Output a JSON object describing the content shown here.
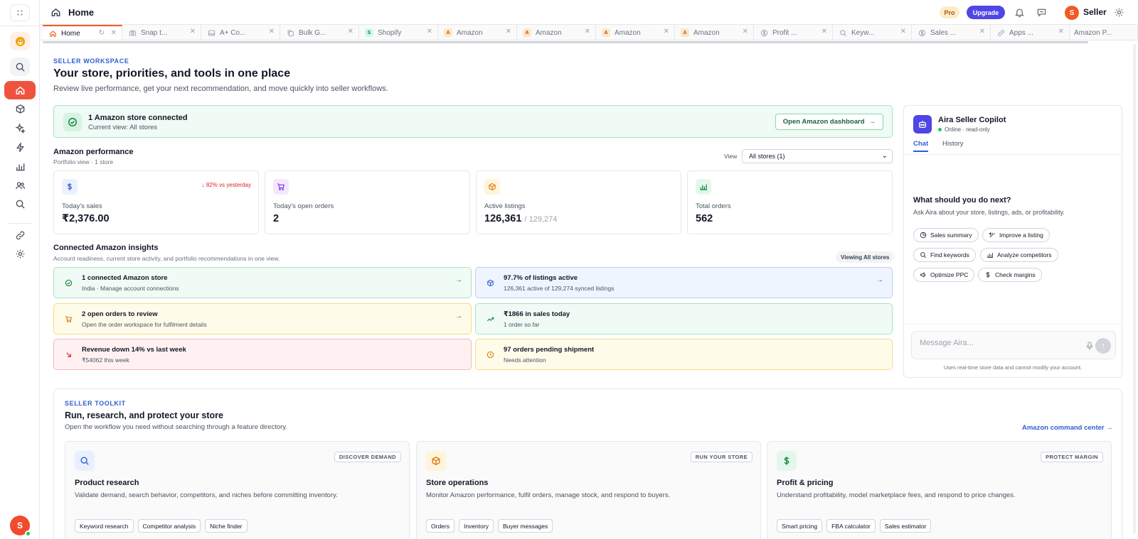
{
  "topbar": {
    "title": "Home",
    "pro_badge": "Pro",
    "upgrade_label": "Upgrade",
    "user_initial": "S",
    "user_name": "Seller"
  },
  "sidebar": {
    "avatar_initial": "S"
  },
  "tabs": [
    {
      "label": "Home"
    },
    {
      "label": "Snap t..."
    },
    {
      "label": "A+ Co..."
    },
    {
      "label": "Bulk G..."
    },
    {
      "label": "Shopify",
      "badge": "S"
    },
    {
      "label": "Amazon",
      "badge": "A"
    },
    {
      "label": "Amazon",
      "badge": "A"
    },
    {
      "label": "Amazon",
      "badge": "A"
    },
    {
      "label": "Amazon",
      "badge": "A"
    },
    {
      "label": "Profit ..."
    },
    {
      "label": "Keyw..."
    },
    {
      "label": "Sales ..."
    },
    {
      "label": "Apps ..."
    },
    {
      "label": "Amazon P..."
    }
  ],
  "hero": {
    "eyebrow": "SELLER WORKSPACE",
    "title": "Your store, priorities, and tools in one place",
    "subtitle": "Review live performance, get your next recommendation, and move quickly into seller workflows."
  },
  "connected": {
    "title": "1 Amazon store connected",
    "subtitle": "Current view: All stores",
    "button_label": "Open Amazon dashboard"
  },
  "performance": {
    "title": "Amazon performance",
    "subtitle": "Portfolio view · 1 store",
    "view_label": "View",
    "view_value": "All stores (1)",
    "kpis": [
      {
        "label": "Today's sales",
        "value": "₹2,376.00",
        "delta": "↓ 82% vs yesterday",
        "icon": "dollar-icon"
      },
      {
        "label": "Today's open orders",
        "value": "2",
        "icon": "cart-icon"
      },
      {
        "label": "Active listings",
        "value": "126,361",
        "value_total": "/ 129,274",
        "icon": "box-icon"
      },
      {
        "label": "Total orders",
        "value": "562",
        "icon": "bar-chart-icon"
      }
    ]
  },
  "insights": {
    "title": "Connected Amazon insights",
    "subtitle": "Account readiness, current store activity, and portfolio recommendations in one view.",
    "badge": "Viewing All stores",
    "items": [
      {
        "title": "1 connected Amazon store",
        "subtitle": "India · Manage account connections"
      },
      {
        "title": "97.7% of listings active",
        "subtitle": "126,361 active of 129,274 synced listings"
      },
      {
        "title": "2 open orders to review",
        "subtitle": "Open the order workspace for fulfilment details"
      },
      {
        "title": "₹1866 in sales today",
        "subtitle": "1 order so far"
      },
      {
        "title": "Revenue down 14% vs last week",
        "subtitle": "₹54062 this week"
      },
      {
        "title": "97 orders pending shipment",
        "subtitle": "Needs attention"
      }
    ]
  },
  "copilot": {
    "name": "Aira Seller Copilot",
    "status": "Online · read-only",
    "tabs": [
      "Chat",
      "History"
    ],
    "question": "What should you do next?",
    "question_sub": "Ask Aira about your store, listings, ads, or profitability.",
    "chips": [
      "Sales summary",
      "Improve a listing",
      "Find keywords",
      "Analyze competitors",
      "Optimize PPC",
      "Check margins"
    ],
    "input_placeholder": "Message Aira...",
    "disclaimer": "Uses real-time store data and cannot modify your account."
  },
  "toolkit": {
    "eyebrow": "SELLER TOOLKIT",
    "title": "Run, research, and protect your store",
    "subtitle": "Open the workflow you need without searching through a feature directory.",
    "command_link": "Amazon command center",
    "tools": [
      {
        "badge": "DISCOVER DEMAND",
        "name": "Product research",
        "description": "Validate demand, search behavior, competitors, and niches before committing inventory.",
        "chips": [
          "Keyword research",
          "Competitor analysis",
          "Niche finder"
        ]
      },
      {
        "badge": "RUN YOUR STORE",
        "name": "Store operations",
        "description": "Monitor Amazon performance, fulfil orders, manage stock, and respond to buyers.",
        "chips": [
          "Orders",
          "Inventory",
          "Buyer messages"
        ]
      },
      {
        "badge": "PROTECT MARGIN",
        "name": "Profit & pricing",
        "description": "Understand profitability, model marketplace fees, and respond to price changes.",
        "chips": [
          "Smart pricing",
          "FBA calculator",
          "Sales estimator"
        ]
      }
    ]
  }
}
